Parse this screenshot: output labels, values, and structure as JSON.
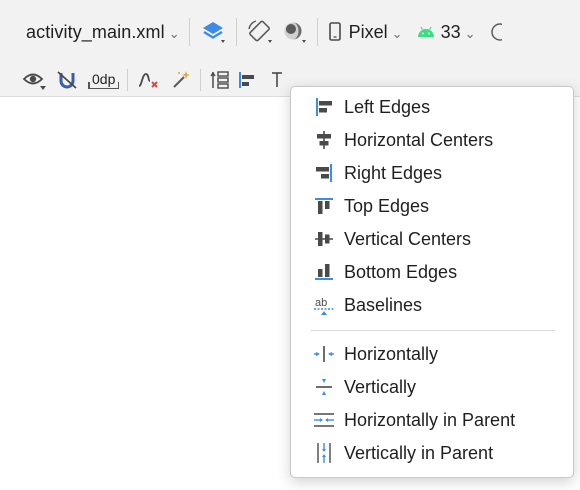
{
  "toolbar": {
    "file_name": "activity_main.xml",
    "device": "Pixel",
    "api_level": "33",
    "default_margin": "0dp"
  },
  "icons": {
    "design_surface": "layers-icon",
    "orientation": "rotate-icon",
    "theme": "theme-circle-icon",
    "device": "phone-icon",
    "api": "android-icon",
    "view_options": "eye-icon",
    "autoconnect": "magnet-off-icon",
    "clear_constraints": "clear-constraints-icon",
    "infer_constraints": "magic-wand-icon",
    "pack": "pack-icon",
    "align": "align-icon",
    "guidelines": "guidelines-icon"
  },
  "colors": {
    "accent_blue": "#3d8be8",
    "android_green": "#3ddc84",
    "icon_dark": "#4a4a4a",
    "error_red": "#e0473e"
  },
  "menu": {
    "edges": [
      {
        "label": "Left Edges",
        "icon": "align-left-edges-icon"
      },
      {
        "label": "Horizontal Centers",
        "icon": "align-horizontal-centers-icon"
      },
      {
        "label": "Right Edges",
        "icon": "align-right-edges-icon"
      },
      {
        "label": "Top Edges",
        "icon": "align-top-edges-icon"
      },
      {
        "label": "Vertical Centers",
        "icon": "align-vertical-centers-icon"
      },
      {
        "label": "Bottom Edges",
        "icon": "align-bottom-edges-icon"
      },
      {
        "label": "Baselines",
        "icon": "align-baselines-icon"
      }
    ],
    "centering": [
      {
        "label": "Horizontally",
        "icon": "center-horizontally-icon"
      },
      {
        "label": "Vertically",
        "icon": "center-vertically-icon"
      },
      {
        "label": "Horizontally in Parent",
        "icon": "center-horizontally-in-parent-icon"
      },
      {
        "label": "Vertically in Parent",
        "icon": "center-vertically-in-parent-icon"
      }
    ]
  }
}
